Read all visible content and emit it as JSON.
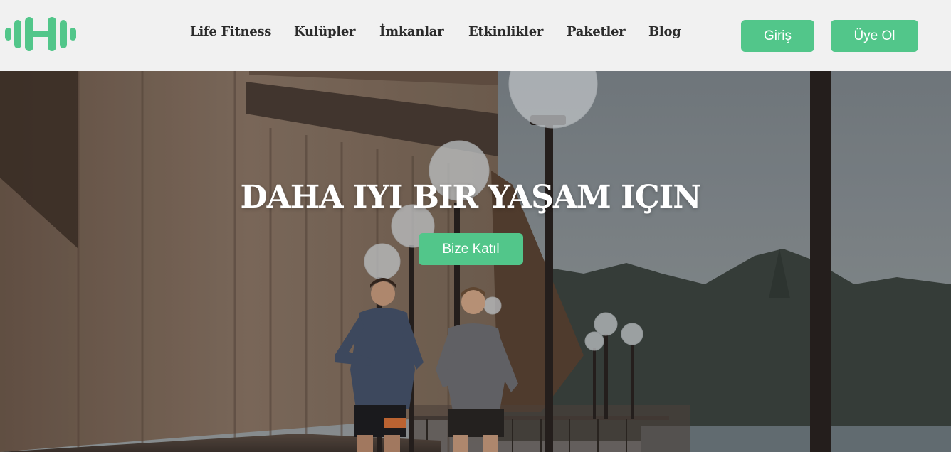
{
  "brand": {
    "logo_icon": "dumbbell-icon",
    "accent_color": "#52c68a"
  },
  "nav": {
    "items": [
      {
        "label": "Life Fitness"
      },
      {
        "label": "Kulüpler"
      },
      {
        "label": "İmkanlar"
      },
      {
        "label": "Etkinlikler"
      },
      {
        "label": "Paketler"
      },
      {
        "label": "Blog"
      }
    ]
  },
  "auth": {
    "login_label": "Giriş",
    "signup_label": "Üye Ol"
  },
  "hero": {
    "title": "DAHA IYI BIR YAŞAM IÇIN",
    "cta_label": "Bize Katıl",
    "background": "photo-two-runners-waterfront"
  }
}
